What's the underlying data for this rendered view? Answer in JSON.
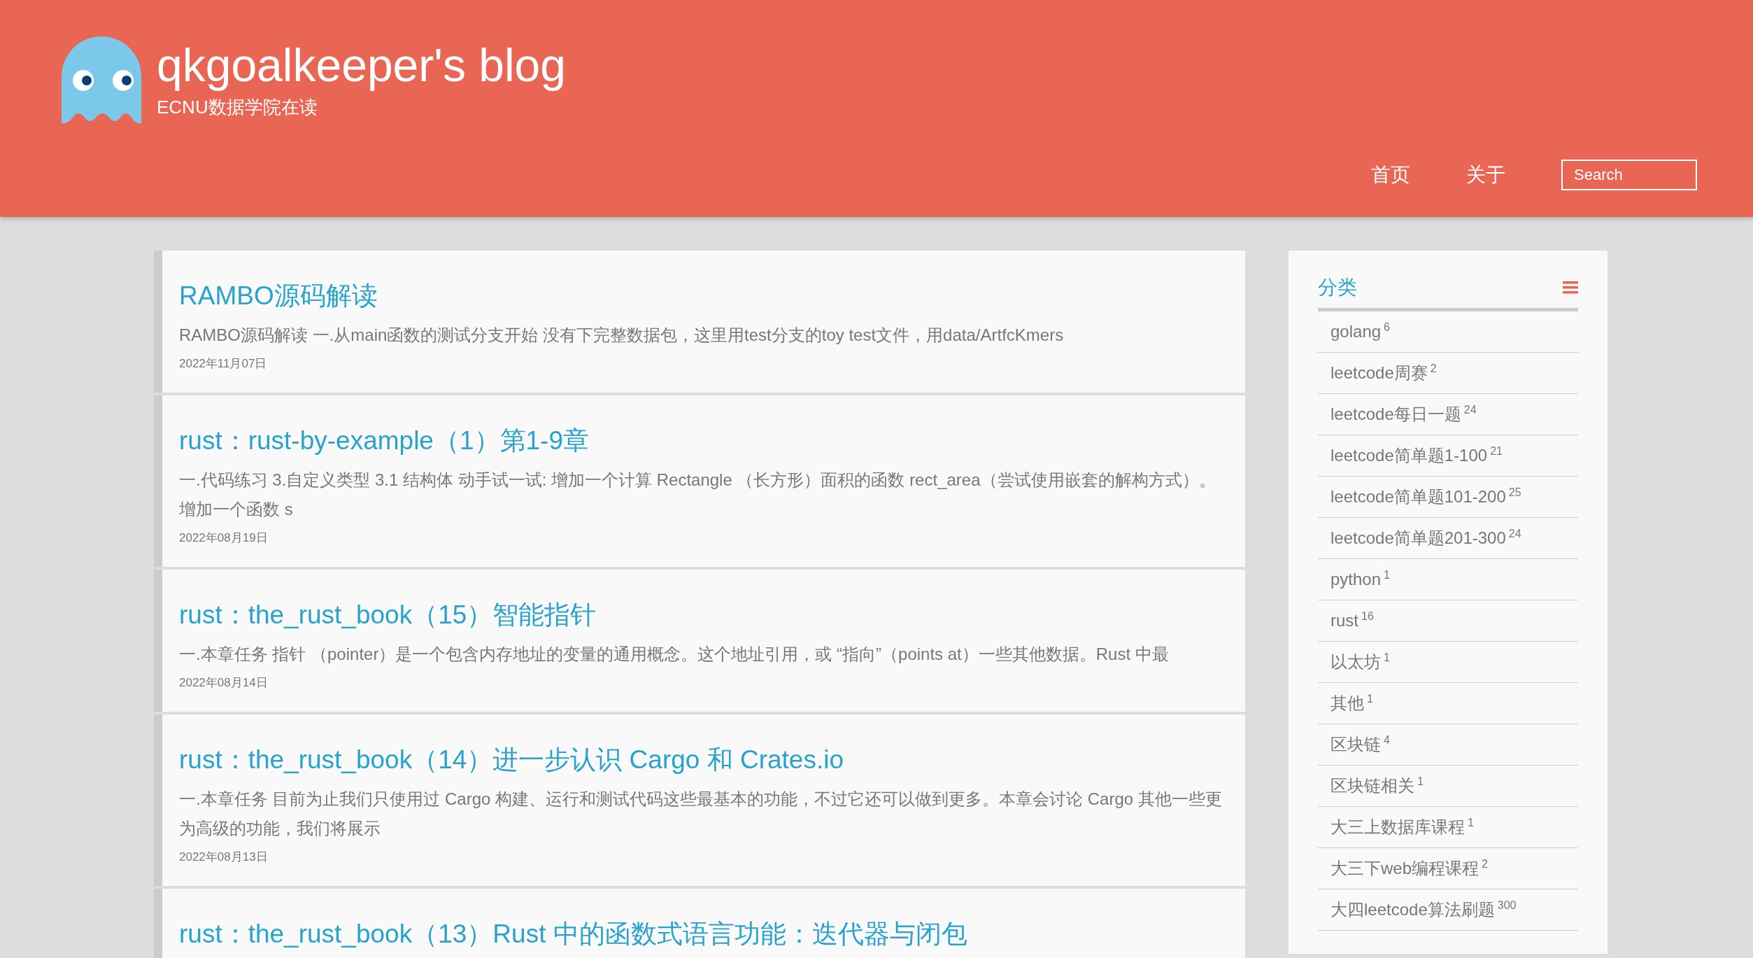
{
  "header": {
    "title": "qkgoalkeeper's blog",
    "subtitle": "ECNU数据学院在读",
    "nav": [
      {
        "label": "首页"
      },
      {
        "label": "关于"
      }
    ],
    "search": {
      "placeholder": "Search"
    }
  },
  "posts": [
    {
      "title": "RAMBO源码解读",
      "excerpt": "RAMBO源码解读 一.从main函数的测试分支开始 没有下完整数据包，这里用test分支的toy test文件，用data/ArtfcKmers",
      "date": "2022年11月07日"
    },
    {
      "title": "rust：rust-by-example（1）第1-9章",
      "excerpt": "一.代码练习 3.自定义类型 3.1 结构体 动手试一试: 增加一个计算 Rectangle （长方形）面积的函数 rect_area（尝试使用嵌套的解构方式）。增加一个函数 s",
      "date": "2022年08月19日"
    },
    {
      "title": "rust：the_rust_book（15）智能指针",
      "excerpt": "一.本章任务 指针 （pointer）是一个包含内存地址的变量的通用概念。这个地址引用，或 “指向”（points at）一些其他数据。Rust 中最",
      "date": "2022年08月14日"
    },
    {
      "title": "rust：the_rust_book（14）进一步认识 Cargo 和 Crates.io",
      "excerpt": "一.本章任务 目前为止我们只使用过 Cargo 构建、运行和测试代码这些最基本的功能，不过它还可以做到更多。本章会讨论 Cargo 其他一些更为高级的功能，我们将展示",
      "date": "2022年08月13日"
    },
    {
      "title": "rust：the_rust_book（13）Rust 中的函数式语言功能：迭代器与闭包"
    }
  ],
  "sidebar": {
    "title": "分类",
    "categories": [
      {
        "name": "golang",
        "count": "6"
      },
      {
        "name": "leetcode周赛",
        "count": "2"
      },
      {
        "name": "leetcode每日一题",
        "count": "24"
      },
      {
        "name": "leetcode简单题1-100",
        "count": "21"
      },
      {
        "name": "leetcode简单题101-200",
        "count": "25"
      },
      {
        "name": "leetcode简单题201-300",
        "count": "24"
      },
      {
        "name": "python",
        "count": "1"
      },
      {
        "name": "rust",
        "count": "16"
      },
      {
        "name": "以太坊",
        "count": "1"
      },
      {
        "name": "其他",
        "count": "1"
      },
      {
        "name": "区块链",
        "count": "4"
      },
      {
        "name": "区块链相关",
        "count": "1"
      },
      {
        "name": "大三上数据库课程",
        "count": "1"
      },
      {
        "name": "大三下web编程课程",
        "count": "2"
      },
      {
        "name": "大四leetcode算法刷题",
        "count": "300"
      }
    ]
  }
}
